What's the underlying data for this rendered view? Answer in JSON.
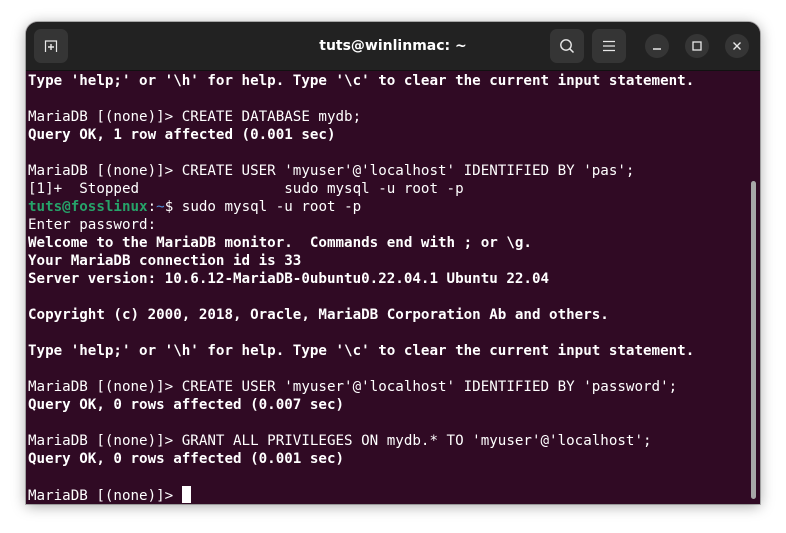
{
  "window": {
    "title": "tuts@winlinmac: ~",
    "buttons": {
      "new_tab": "new-tab-icon",
      "search": "search-icon",
      "menu": "hamburger-menu-icon",
      "minimize": "minimize-icon",
      "maximize": "maximize-icon",
      "close": "close-icon"
    }
  },
  "terminal": {
    "colors": {
      "background": "#300a24",
      "foreground": "#ffffff",
      "prompt_user": "#26a269",
      "prompt_path": "#4e8fd8"
    },
    "lines": [
      {
        "text": "Type 'help;' or '\\h' for help. Type '\\c' to clear the current input statement.",
        "bold": true
      },
      {
        "text": "",
        "bold": false
      },
      {
        "text": "MariaDB [(none)]> CREATE DATABASE mydb;",
        "bold": false
      },
      {
        "text": "Query OK, 1 row affected (0.001 sec)",
        "bold": true
      },
      {
        "text": "",
        "bold": false
      },
      {
        "text": "MariaDB [(none)]> CREATE USER 'myuser'@'localhost' IDENTIFIED BY 'pas';",
        "bold": false
      },
      {
        "text": "[1]+  Stopped                 sudo mysql -u root -p",
        "bold": false
      },
      {
        "prompt_user": "tuts@fosslinux",
        "prompt_sep": ":",
        "prompt_path": "~",
        "prompt_sym": "$ ",
        "command": "sudo mysql -u root -p"
      },
      {
        "text": "Enter password: ",
        "bold": false
      },
      {
        "text": "Welcome to the MariaDB monitor.  Commands end with ; or \\g.",
        "bold": true
      },
      {
        "text": "Your MariaDB connection id is 33",
        "bold": true
      },
      {
        "text": "Server version: 10.6.12-MariaDB-0ubuntu0.22.04.1 Ubuntu 22.04",
        "bold": true
      },
      {
        "text": "",
        "bold": false
      },
      {
        "text": "Copyright (c) 2000, 2018, Oracle, MariaDB Corporation Ab and others.",
        "bold": true
      },
      {
        "text": "",
        "bold": false
      },
      {
        "text": "Type 'help;' or '\\h' for help. Type '\\c' to clear the current input statement.",
        "bold": true
      },
      {
        "text": "",
        "bold": false
      },
      {
        "text": "MariaDB [(none)]> CREATE USER 'myuser'@'localhost' IDENTIFIED BY 'password';",
        "bold": false
      },
      {
        "text": "Query OK, 0 rows affected (0.007 sec)",
        "bold": true
      },
      {
        "text": "",
        "bold": false
      },
      {
        "text": "MariaDB [(none)]> GRANT ALL PRIVILEGES ON mydb.* TO 'myuser'@'localhost';",
        "bold": false
      },
      {
        "text": "Query OK, 0 rows affected (0.001 sec)",
        "bold": true
      },
      {
        "text": "",
        "bold": false
      }
    ],
    "current_prompt": "MariaDB [(none)]> ",
    "current_input": ""
  }
}
